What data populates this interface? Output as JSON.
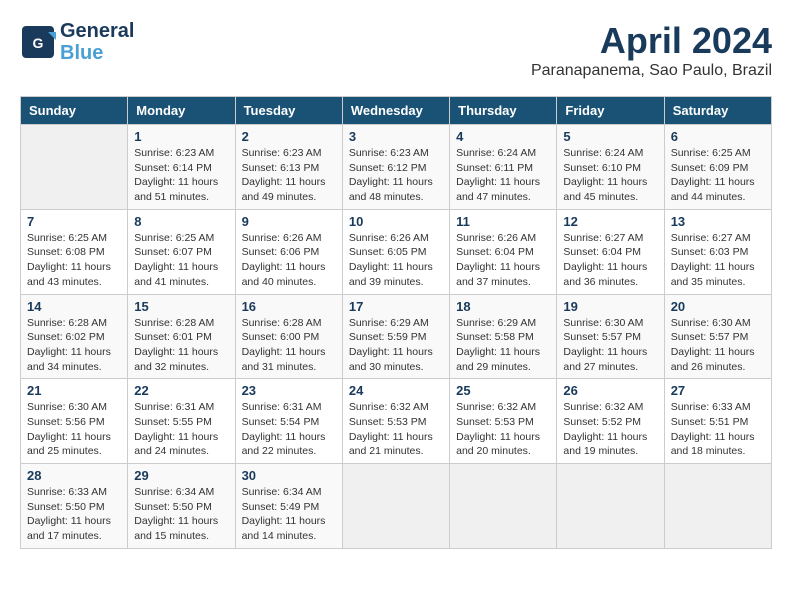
{
  "header": {
    "logo_line1": "General",
    "logo_line2": "Blue",
    "title": "April 2024",
    "location": "Paranapanema, Sao Paulo, Brazil"
  },
  "weekdays": [
    "Sunday",
    "Monday",
    "Tuesday",
    "Wednesday",
    "Thursday",
    "Friday",
    "Saturday"
  ],
  "weeks": [
    [
      {
        "day": "",
        "info": ""
      },
      {
        "day": "1",
        "info": "Sunrise: 6:23 AM\nSunset: 6:14 PM\nDaylight: 11 hours\nand 51 minutes."
      },
      {
        "day": "2",
        "info": "Sunrise: 6:23 AM\nSunset: 6:13 PM\nDaylight: 11 hours\nand 49 minutes."
      },
      {
        "day": "3",
        "info": "Sunrise: 6:23 AM\nSunset: 6:12 PM\nDaylight: 11 hours\nand 48 minutes."
      },
      {
        "day": "4",
        "info": "Sunrise: 6:24 AM\nSunset: 6:11 PM\nDaylight: 11 hours\nand 47 minutes."
      },
      {
        "day": "5",
        "info": "Sunrise: 6:24 AM\nSunset: 6:10 PM\nDaylight: 11 hours\nand 45 minutes."
      },
      {
        "day": "6",
        "info": "Sunrise: 6:25 AM\nSunset: 6:09 PM\nDaylight: 11 hours\nand 44 minutes."
      }
    ],
    [
      {
        "day": "7",
        "info": "Sunrise: 6:25 AM\nSunset: 6:08 PM\nDaylight: 11 hours\nand 43 minutes."
      },
      {
        "day": "8",
        "info": "Sunrise: 6:25 AM\nSunset: 6:07 PM\nDaylight: 11 hours\nand 41 minutes."
      },
      {
        "day": "9",
        "info": "Sunrise: 6:26 AM\nSunset: 6:06 PM\nDaylight: 11 hours\nand 40 minutes."
      },
      {
        "day": "10",
        "info": "Sunrise: 6:26 AM\nSunset: 6:05 PM\nDaylight: 11 hours\nand 39 minutes."
      },
      {
        "day": "11",
        "info": "Sunrise: 6:26 AM\nSunset: 6:04 PM\nDaylight: 11 hours\nand 37 minutes."
      },
      {
        "day": "12",
        "info": "Sunrise: 6:27 AM\nSunset: 6:04 PM\nDaylight: 11 hours\nand 36 minutes."
      },
      {
        "day": "13",
        "info": "Sunrise: 6:27 AM\nSunset: 6:03 PM\nDaylight: 11 hours\nand 35 minutes."
      }
    ],
    [
      {
        "day": "14",
        "info": "Sunrise: 6:28 AM\nSunset: 6:02 PM\nDaylight: 11 hours\nand 34 minutes."
      },
      {
        "day": "15",
        "info": "Sunrise: 6:28 AM\nSunset: 6:01 PM\nDaylight: 11 hours\nand 32 minutes."
      },
      {
        "day": "16",
        "info": "Sunrise: 6:28 AM\nSunset: 6:00 PM\nDaylight: 11 hours\nand 31 minutes."
      },
      {
        "day": "17",
        "info": "Sunrise: 6:29 AM\nSunset: 5:59 PM\nDaylight: 11 hours\nand 30 minutes."
      },
      {
        "day": "18",
        "info": "Sunrise: 6:29 AM\nSunset: 5:58 PM\nDaylight: 11 hours\nand 29 minutes."
      },
      {
        "day": "19",
        "info": "Sunrise: 6:30 AM\nSunset: 5:57 PM\nDaylight: 11 hours\nand 27 minutes."
      },
      {
        "day": "20",
        "info": "Sunrise: 6:30 AM\nSunset: 5:57 PM\nDaylight: 11 hours\nand 26 minutes."
      }
    ],
    [
      {
        "day": "21",
        "info": "Sunrise: 6:30 AM\nSunset: 5:56 PM\nDaylight: 11 hours\nand 25 minutes."
      },
      {
        "day": "22",
        "info": "Sunrise: 6:31 AM\nSunset: 5:55 PM\nDaylight: 11 hours\nand 24 minutes."
      },
      {
        "day": "23",
        "info": "Sunrise: 6:31 AM\nSunset: 5:54 PM\nDaylight: 11 hours\nand 22 minutes."
      },
      {
        "day": "24",
        "info": "Sunrise: 6:32 AM\nSunset: 5:53 PM\nDaylight: 11 hours\nand 21 minutes."
      },
      {
        "day": "25",
        "info": "Sunrise: 6:32 AM\nSunset: 5:53 PM\nDaylight: 11 hours\nand 20 minutes."
      },
      {
        "day": "26",
        "info": "Sunrise: 6:32 AM\nSunset: 5:52 PM\nDaylight: 11 hours\nand 19 minutes."
      },
      {
        "day": "27",
        "info": "Sunrise: 6:33 AM\nSunset: 5:51 PM\nDaylight: 11 hours\nand 18 minutes."
      }
    ],
    [
      {
        "day": "28",
        "info": "Sunrise: 6:33 AM\nSunset: 5:50 PM\nDaylight: 11 hours\nand 17 minutes."
      },
      {
        "day": "29",
        "info": "Sunrise: 6:34 AM\nSunset: 5:50 PM\nDaylight: 11 hours\nand 15 minutes."
      },
      {
        "day": "30",
        "info": "Sunrise: 6:34 AM\nSunset: 5:49 PM\nDaylight: 11 hours\nand 14 minutes."
      },
      {
        "day": "",
        "info": ""
      },
      {
        "day": "",
        "info": ""
      },
      {
        "day": "",
        "info": ""
      },
      {
        "day": "",
        "info": ""
      }
    ]
  ]
}
